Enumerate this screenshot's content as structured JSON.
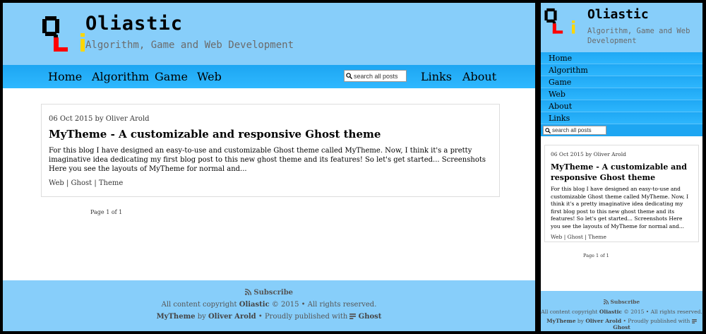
{
  "site": {
    "title": "Oliastic",
    "subtitle": "Algorithm, Game and Web Development",
    "colors": {
      "header_bg": "#87cefa",
      "nav_bg": "#1da6f2",
      "logo_black": "#000000",
      "logo_red": "#ff0000",
      "logo_yellow": "#ffd700"
    }
  },
  "nav": {
    "home": "Home",
    "algorithm": "Algorithm",
    "game": "Game",
    "web": "Web",
    "links": "Links",
    "about": "About"
  },
  "search": {
    "placeholder": "search all posts",
    "icon": "search-icon"
  },
  "post": {
    "date": "06 Oct 2015",
    "by": "by",
    "author": "Oliver Arold",
    "title": "MyTheme - A customizable and responsive Ghost theme",
    "excerpt": "For this blog I have designed an easy-to-use and customizable Ghost theme called MyTheme. Now, I think it's a pretty imaginative idea dedicating my first blog post to this new ghost theme and its features! So let's get started... Screenshots Here you see the layouts of MyTheme for normal and...",
    "tags": [
      "Web",
      "Ghost",
      "Theme"
    ]
  },
  "pagination": {
    "label": "Page 1 of 1"
  },
  "footer": {
    "subscribe": "Subscribe",
    "copyright_pre": "All content copyright",
    "copyright_brand": "Oliastic",
    "copyright_post": "© 2015 • All rights reserved.",
    "theme": "MyTheme",
    "by": "by",
    "theme_author": "Oliver Arold",
    "published_pre": "• Proudly published with",
    "platform": "Ghost"
  }
}
